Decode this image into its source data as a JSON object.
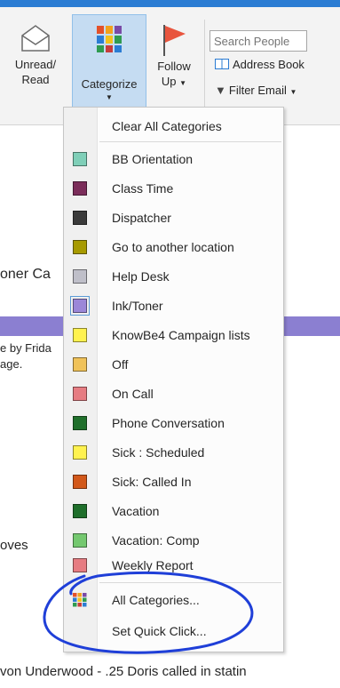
{
  "ribbon": {
    "unread_read_line1": "Unread/",
    "unread_read_line2": "Read",
    "categorize_label": "Categorize",
    "follow_up_line1": "Follow",
    "follow_up_line2": "Up",
    "search_people_placeholder": "Search People",
    "address_book_label": "Address Book",
    "filter_email_label": "Filter Email"
  },
  "background": {
    "text_oner": "oner Ca",
    "text_frida": "e by Frida",
    "text_age": "age.",
    "text_oves": "oves",
    "text_bottom": "von Underwood - .25 Doris called in statin"
  },
  "menu": {
    "clear_all": "Clear All Categories",
    "categories": [
      {
        "name": "BB Orientation",
        "color": "#7fcfb8"
      },
      {
        "name": "Class  Time",
        "color": "#7b2d5a"
      },
      {
        "name": "Dispatcher",
        "color": "#3a3a3a"
      },
      {
        "name": "Go to another location",
        "color": "#a79a00"
      },
      {
        "name": "Help Desk",
        "color": "#bfbfc9"
      },
      {
        "name": "Ink/Toner",
        "color": "#9b87d8"
      },
      {
        "name": "KnowBe4 Campaign lists",
        "color": "#fff24f"
      },
      {
        "name": "Off",
        "color": "#f0c259"
      },
      {
        "name": "On Call",
        "color": "#e67c82"
      },
      {
        "name": "Phone Conversation",
        "color": "#1f6f2b"
      },
      {
        "name": "Sick : Scheduled",
        "color": "#fff24f"
      },
      {
        "name": "Sick: Called In",
        "color": "#d2581a"
      },
      {
        "name": "Vacation",
        "color": "#1f6f2b"
      },
      {
        "name": "Vacation: Comp",
        "color": "#74c86f"
      },
      {
        "name": "Weekly Report",
        "color": "#e67c82"
      }
    ],
    "all_categories": "All Categories...",
    "set_quick_click": "Set Quick Click..."
  },
  "colors": {
    "ribbon_bg": "#f3f3f3",
    "selected_button": "#c5dcf2",
    "purple_bar": "#8b7fd1",
    "annotation_ink": "#1f3fd8"
  }
}
